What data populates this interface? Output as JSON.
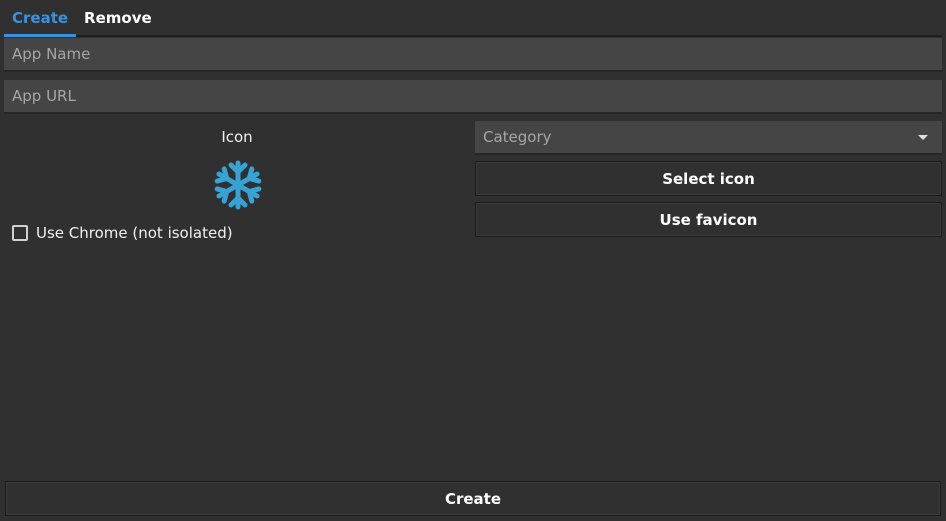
{
  "tabs": [
    {
      "label": "Create",
      "active": true
    },
    {
      "label": "Remove",
      "active": false
    }
  ],
  "form": {
    "app_name": {
      "value": "",
      "placeholder": "App Name"
    },
    "app_url": {
      "value": "",
      "placeholder": "App URL"
    },
    "icon_label": "Icon",
    "icon_name": "snowflake-icon",
    "icon_color": "#36a3d4",
    "use_chrome_label": "Use Chrome (not isolated)",
    "use_chrome_checked": false,
    "category": {
      "value": "Category"
    },
    "select_icon_label": "Select icon",
    "use_favicon_label": "Use favicon",
    "create_label": "Create"
  },
  "colors": {
    "background": "#303030",
    "accent": "#3a92df",
    "input_bg": "#454545"
  }
}
